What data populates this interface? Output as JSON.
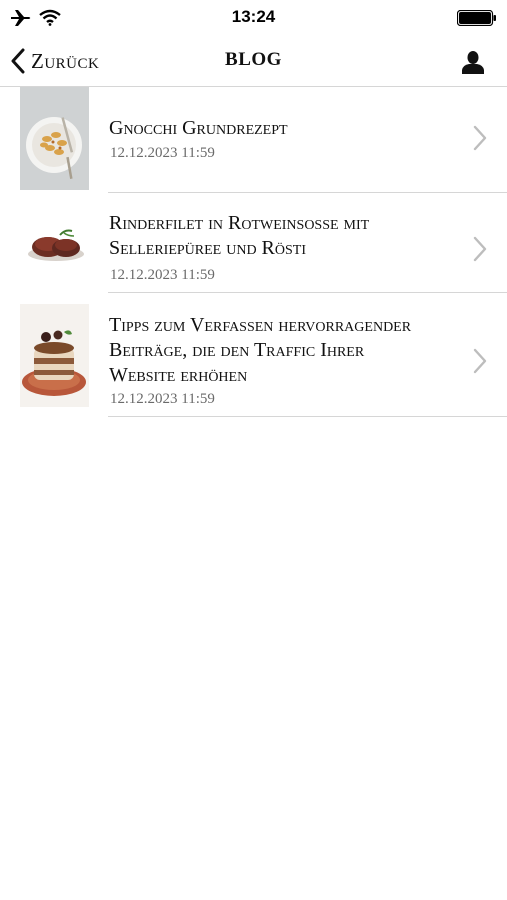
{
  "status_bar": {
    "time": "13:24"
  },
  "nav": {
    "back_label": "Zurück",
    "title": "BLOG"
  },
  "posts": [
    {
      "title": "Gnocchi Grundrezept",
      "date": "12.12.2023 11:59"
    },
    {
      "title_lines": [
        "Rinderfilet in Rotweinsosse mit",
        "Selleriepüree und Rösti"
      ],
      "date": "12.12.2023 11:59"
    },
    {
      "title_lines": [
        "Tipps zum Verfassen hervorragender",
        "Beiträge, die den Traffic Ihrer",
        "Website erhöhen"
      ],
      "date": "12.12.2023 11:59"
    }
  ]
}
